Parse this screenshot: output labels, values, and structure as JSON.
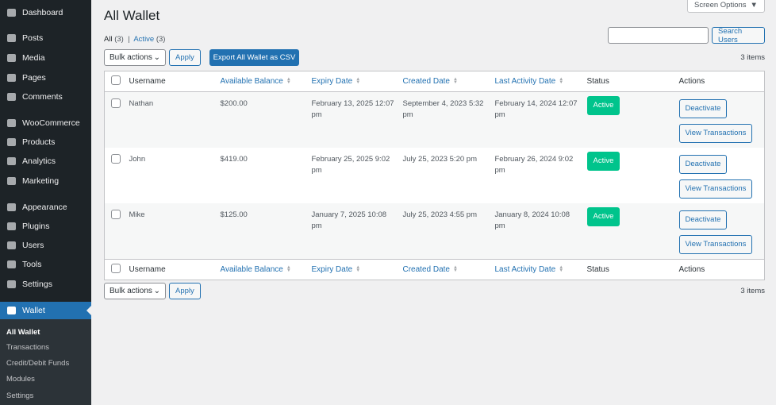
{
  "sidebar": {
    "items": [
      {
        "label": "Dashboard",
        "icon": "dashboard-icon"
      },
      {
        "label": "Posts",
        "icon": "pin-icon"
      },
      {
        "label": "Media",
        "icon": "media-icon"
      },
      {
        "label": "Pages",
        "icon": "pages-icon"
      },
      {
        "label": "Comments",
        "icon": "comment-icon"
      },
      {
        "label": "WooCommerce",
        "icon": "woocommerce-icon"
      },
      {
        "label": "Products",
        "icon": "archive-icon"
      },
      {
        "label": "Analytics",
        "icon": "bar-chart-icon"
      },
      {
        "label": "Marketing",
        "icon": "megaphone-icon"
      },
      {
        "label": "Appearance",
        "icon": "brush-icon"
      },
      {
        "label": "Plugins",
        "icon": "plug-icon"
      },
      {
        "label": "Users",
        "icon": "user-icon"
      },
      {
        "label": "Tools",
        "icon": "wrench-icon"
      },
      {
        "label": "Settings",
        "icon": "settings-icon"
      },
      {
        "label": "Wallet",
        "icon": "wallet-icon"
      }
    ],
    "submenu": [
      "All Wallet",
      "Transactions",
      "Credit/Debit Funds",
      "Modules",
      "Settings"
    ]
  },
  "header": {
    "title": "All Wallet",
    "screen_options": "Screen Options"
  },
  "filters": {
    "all": "All",
    "all_count": "(3)",
    "sep": "|",
    "active": "Active",
    "active_count": "(3)"
  },
  "toolbar": {
    "bulk": "Bulk actions",
    "apply": "Apply",
    "export": "Export All Wallet as CSV",
    "search_placeholder": "",
    "search_btn": "Search Users",
    "count": "3 items"
  },
  "columns": [
    "Username",
    "Available Balance",
    "Expiry Date",
    "Created Date",
    "Last Activity Date",
    "Status",
    "Actions"
  ],
  "rows": [
    {
      "user": "Nathan",
      "balance": "$200.00",
      "expiry": "February 13, 2025 12:07 pm",
      "created": "September 4, 2023 5:32 pm",
      "last": "February 14, 2024 12:07 pm",
      "status": "Active"
    },
    {
      "user": "John",
      "balance": "$419.00",
      "expiry": "February 25, 2025 9:02 pm",
      "created": "July 25, 2023 5:20 pm",
      "last": "February 26, 2024 9:02 pm",
      "status": "Active"
    },
    {
      "user": "Mike",
      "balance": "$125.00",
      "expiry": "January 7, 2025 10:08 pm",
      "created": "July 25, 2023 4:55 pm",
      "last": "January 8, 2024 10:08 pm",
      "status": "Active"
    }
  ],
  "actions": {
    "deactivate": "Deactivate",
    "view": "View Transactions"
  },
  "colors": {
    "accent": "#2271b1",
    "active": "#00c48c",
    "sidebar": "#1d2327"
  }
}
